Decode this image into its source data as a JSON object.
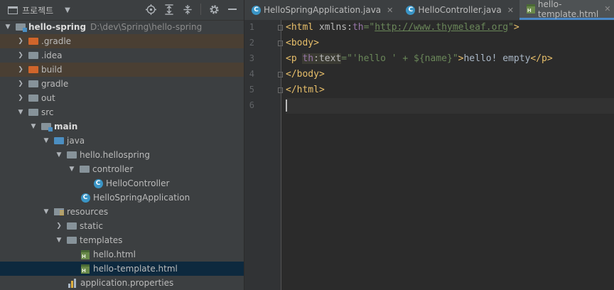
{
  "project_panel": {
    "title": "프로젝트",
    "tree": [
      {
        "label": "hello-spring",
        "path": "D:\\dev\\Spring\\hello-spring"
      },
      {
        "label": ".gradle"
      },
      {
        "label": ".idea"
      },
      {
        "label": "build"
      },
      {
        "label": "gradle"
      },
      {
        "label": "out"
      },
      {
        "label": "src"
      },
      {
        "label": "main"
      },
      {
        "label": "java"
      },
      {
        "label": "hello.hellospring"
      },
      {
        "label": "controller"
      },
      {
        "label": "HelloController"
      },
      {
        "label": "HelloSpringApplication"
      },
      {
        "label": "resources"
      },
      {
        "label": "static"
      },
      {
        "label": "templates"
      },
      {
        "label": "hello.html"
      },
      {
        "label": "hello-template.html"
      },
      {
        "label": "application.properties"
      }
    ]
  },
  "editor": {
    "tabs": [
      {
        "label": "HelloSpringApplication.java"
      },
      {
        "label": "HelloController.java"
      },
      {
        "label": "hello-template.html"
      }
    ],
    "line_numbers": [
      "1",
      "2",
      "3",
      "4",
      "5",
      "6"
    ],
    "code": {
      "l1": {
        "open": "<html ",
        "attr": "xmlns",
        "colon": ":",
        "ns": "th",
        "eq": "=",
        "q1": "\"",
        "url": "http://www.thymeleaf.org",
        "q2": "\"",
        "close": ">"
      },
      "l2": {
        "tag": "<body>"
      },
      "l3": {
        "open": "<p ",
        "ns": "th",
        "rest_attr": ":text",
        "eq": "=",
        "val": "\"'hello ' + ${name}\"",
        "gt": ">",
        "text": "hello! empty",
        "close": "</p>"
      },
      "l4": {
        "tag": "</body>"
      },
      "l5": {
        "tag": "</html>"
      }
    }
  }
}
